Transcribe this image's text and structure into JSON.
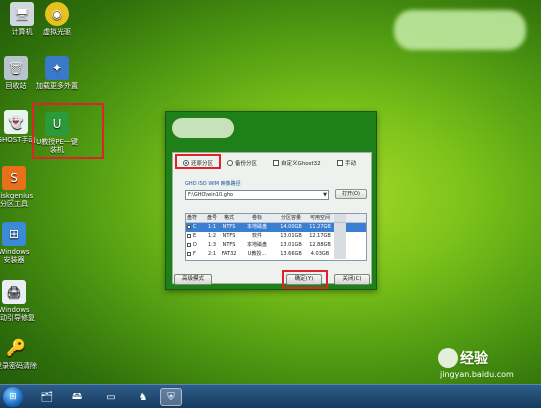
{
  "desktop": {
    "icons": [
      {
        "id": "computer",
        "label": "计算机",
        "icon": "computer-icon",
        "color": "#cfd8e0"
      },
      {
        "id": "vdrive",
        "label": "虚拟光驱",
        "icon": "disc-icon",
        "color": "#e8c020"
      },
      {
        "id": "recycle",
        "label": "回收站",
        "icon": "recycle-bin-icon",
        "color": "#b8c4cc"
      },
      {
        "id": "loadnet",
        "label": "加载更多外置",
        "icon": "network-icon",
        "color": "#3a78c8"
      },
      {
        "id": "ghost",
        "label": "GHOST手动",
        "icon": "ghost-icon",
        "color": "#e8f4f0"
      },
      {
        "id": "upe",
        "label_lines": [
          "U教授PE一键",
          "装机"
        ],
        "icon": "upe-icon",
        "color": "#2a9a3a"
      },
      {
        "id": "diskgenius",
        "label_lines": [
          "Diskgenius",
          "分区工具"
        ],
        "icon": "diskgenius-icon",
        "color": "#e8701a"
      },
      {
        "id": "winsetup",
        "label_lines": [
          "Windows",
          "安装器"
        ],
        "icon": "windows-setup-icon",
        "color": "#3a8ad8"
      },
      {
        "id": "winboot",
        "label_lines": [
          "Windows",
          "启动引导修复"
        ],
        "icon": "boot-repair-icon",
        "color": "#e8eef4"
      },
      {
        "id": "pwclear",
        "label": "登录密码清除",
        "icon": "key-icon",
        "color": "#e8c81a"
      }
    ]
  },
  "dialog": {
    "radios": {
      "restore": "还原分区",
      "backup": "备份分区",
      "custom": "自定义Ghost32",
      "manual": "手动"
    },
    "path_label": "GHO ISO WIM 映像路径",
    "path_value": "F:\\GHO\\win10.gho",
    "open_button": "打开(O)",
    "table": {
      "headers": [
        "盘符",
        "盘号",
        "格式",
        "卷标",
        "分区容量",
        "可用空间"
      ],
      "rows": [
        {
          "c1": "C",
          "c2": "1:1",
          "c3": "NTFS",
          "c4": "本地磁盘",
          "c5": "14.00GB",
          "c6": "11.27GB",
          "selected": true
        },
        {
          "c1": "E",
          "c2": "1:2",
          "c3": "NTFS",
          "c4": "软件",
          "c5": "13.01GB",
          "c6": "12.17GB",
          "selected": false
        },
        {
          "c1": "D",
          "c2": "1:3",
          "c3": "NTFS",
          "c4": "本地磁盘",
          "c5": "13.01GB",
          "c6": "12.88GB",
          "selected": false
        },
        {
          "c1": "F",
          "c2": "2:1",
          "c3": "FAT32",
          "c4": "U教授...",
          "c5": "13.66GB",
          "c6": "4.03GB",
          "selected": false
        }
      ]
    },
    "advanced_button": "高级模式",
    "ok_button": "确定(Y)",
    "close_button": "关闭(C)"
  },
  "taskbar": {
    "start_icon": "windows-logo-icon",
    "items": [
      "explorer-icon",
      "drive-tool-icon",
      "usb-drive-icon",
      "chess-tool-icon",
      "shield-app-icon"
    ]
  },
  "watermark": {
    "brand": "经验",
    "url": "jingyan.baidu.com"
  },
  "colors": {
    "highlight": "#e0222a",
    "dialog_bg": "#1f7f18",
    "selection": "#3b7fd3"
  }
}
